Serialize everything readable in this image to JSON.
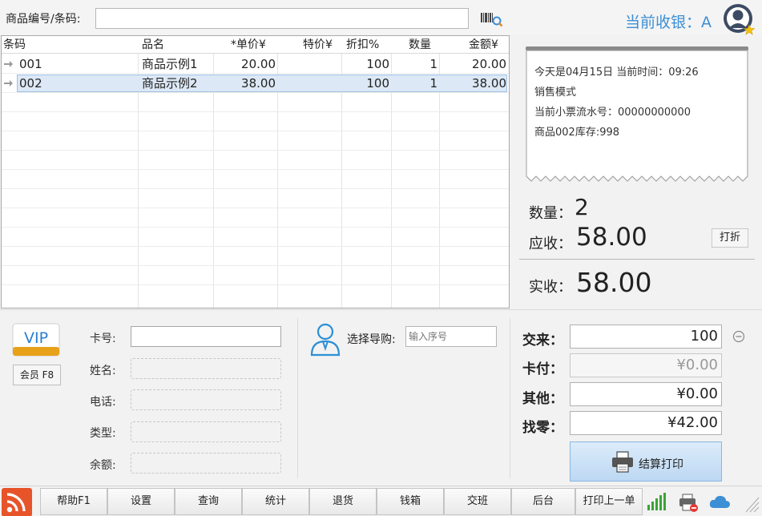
{
  "search": {
    "label": "商品编号/条码:",
    "value": "",
    "placeholder": ""
  },
  "cashier": {
    "label": "当前收银：A"
  },
  "grid": {
    "headers": [
      "条码",
      "品名",
      "*单价¥",
      "特价¥",
      "折扣%",
      "数量",
      "金额¥"
    ],
    "rows": [
      {
        "code": "001",
        "name": "商品示例1",
        "price": "20.00",
        "special": "",
        "discount": "100",
        "qty": "1",
        "amount": "20.00"
      },
      {
        "code": "002",
        "name": "商品示例2",
        "price": "38.00",
        "special": "",
        "discount": "100",
        "qty": "1",
        "amount": "38.00"
      }
    ]
  },
  "receipt": {
    "lines": [
      "今天是04月15日 当前时间：09:26",
      "销售模式",
      "当前小票流水号：00000000000",
      "商品002库存:998"
    ]
  },
  "summary": {
    "qty_label": "数量：",
    "qty_value": "2",
    "due_label": "应收：",
    "due_value": "58.00",
    "discount_button": "打折",
    "paid_label": "实收：",
    "paid_value": "58.00"
  },
  "member": {
    "vip_text": "VIP",
    "member_button": "会员 F8",
    "card_label": "卡号:",
    "card_value": "",
    "name_label": "姓名:",
    "phone_label": "电话:",
    "type_label": "类型:",
    "balance_label": "余额:"
  },
  "guide": {
    "label": "选择导购:",
    "placeholder": "输入序号"
  },
  "payment": {
    "received_label": "交来：",
    "received_value": "100",
    "card_label": "卡付：",
    "card_value": "¥0.00",
    "other_label": "其他：",
    "other_value": "¥0.00",
    "change_label": "找零：",
    "change_value": "¥42.00",
    "checkout_label": "结算打印"
  },
  "toolbar": {
    "buttons": [
      "帮助F1",
      "设置",
      "查询",
      "统计",
      "退货",
      "钱箱",
      "交班",
      "后台",
      "打印上一单"
    ]
  },
  "colors": {
    "accent": "#3c8fd5",
    "vip_blue": "#2a7fd0",
    "rss_orange": "#e8542a",
    "signal_green": "#3aa537"
  },
  "icons": [
    "barcode-scan-icon",
    "user-avatar-icon",
    "star-icon",
    "row-arrow-icon",
    "vip-icon",
    "shop-guide-icon",
    "minus-circle-icon",
    "printer-icon",
    "rss-icon",
    "signal-icon",
    "print-status-icon",
    "cloud-icon"
  ]
}
